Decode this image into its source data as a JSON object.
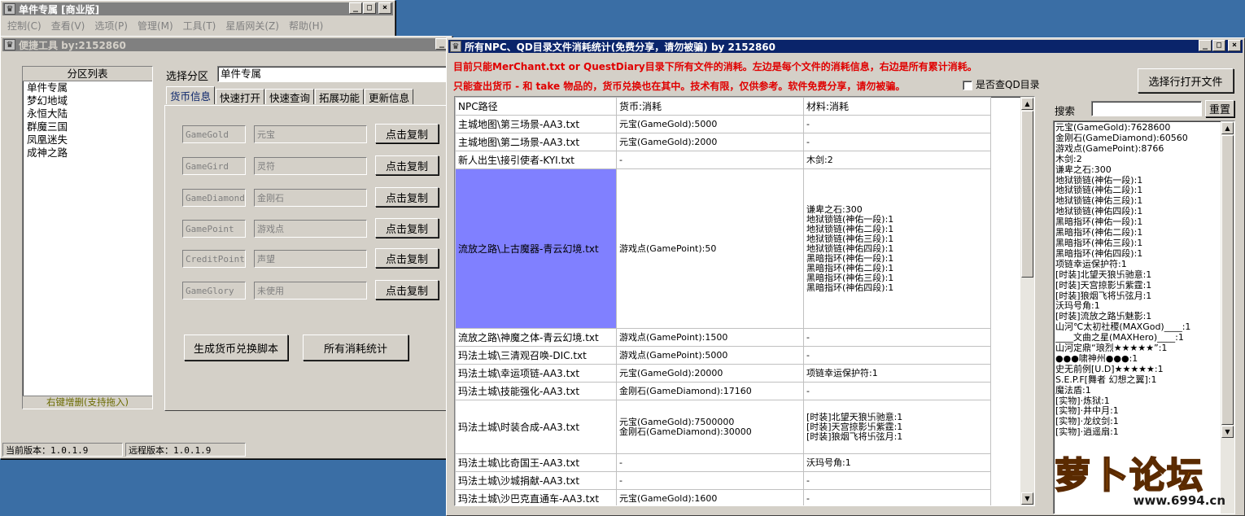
{
  "main_window": {
    "title": "单件专属 [商业版]",
    "menu": [
      "控制(C)",
      "查看(V)",
      "选项(P)",
      "管理(M)",
      "工具(T)",
      "星盾网关(Z)",
      "帮助(H)"
    ]
  },
  "tool_window": {
    "title": "便捷工具   by:2152860",
    "partition": {
      "header": "分区列表",
      "items": [
        "单件专属",
        "梦幻地域",
        "永恒大陆",
        "群魔三国",
        "凤凰迷失",
        "成神之路"
      ],
      "footer": "右键增删(支持拖入)"
    },
    "select_label": "选择分区",
    "select_value": "单件专属",
    "tabs": [
      "货币信息",
      "快速打开",
      "快速查询",
      "拓展功能",
      "更新信息"
    ],
    "currencies": [
      {
        "code": "GameGold",
        "name": "元宝",
        "button": "点击复制"
      },
      {
        "code": "GameGird",
        "name": "灵符",
        "button": "点击复制"
      },
      {
        "code": "GameDiamond",
        "name": "金刚石",
        "button": "点击复制"
      },
      {
        "code": "GamePoint",
        "name": "游戏点",
        "button": "点击复制"
      },
      {
        "code": "CreditPoint",
        "name": "声望",
        "button": "点击复制"
      },
      {
        "code": "GameGlory",
        "name": "未使用",
        "button": "点击复制"
      }
    ],
    "gen_button": "生成货币兑换脚本",
    "stats_button": "所有消耗统计",
    "status_local": "当前版本：1.0.1.9",
    "status_remote": "远程版本：1.0.1.9"
  },
  "stats_window": {
    "title": "所有NPC、QD目录文件消耗统计(免费分享，请勿被骗)    by 2152860",
    "notice1": "目前只能MerChant.txt or QuestDiary目录下所有文件的消耗。左边是每个文件的消耗信息，右边是所有累计消耗。",
    "notice2": "只能查出货币 - 和 take 物品的，货币兑换也在其中。技术有限，仅供参考。软件免费分享，请勿被骗。",
    "checkbox_label": "是否查QD目录",
    "open_button": "选择行打开文件",
    "search_label": "搜索",
    "reset_button": "重置",
    "columns": [
      "NPC路径",
      "货币:消耗",
      "材料:消耗"
    ],
    "rows": [
      {
        "path": "主城地图\\第三场景-AA3.txt",
        "cost": [
          "元宝(GameGold):5000"
        ],
        "mat": [
          "-"
        ]
      },
      {
        "path": "主城地图\\第二场景-AA3.txt",
        "cost": [
          "元宝(GameGold):2000"
        ],
        "mat": [
          "-"
        ]
      },
      {
        "path": "新人出生\\接引使者-KYI.txt",
        "cost": [
          "-"
        ],
        "mat": [
          "木剑:2"
        ]
      },
      {
        "path": "流放之路\\上古魔器-青云幻境.txt",
        "cost": [
          "游戏点(GamePoint):50"
        ],
        "mat": [
          "谦卑之石:300",
          "地狱锁链(神佑一段):1",
          "地狱锁链(神佑二段):1",
          "地狱锁链(神佑三段):1",
          "地狱锁链(神佑四段):1",
          "黑暗指环(神佑一段):1",
          "黑暗指环(神佑二段):1",
          "黑暗指环(神佑三段):1",
          "黑暗指环(神佑四段):1"
        ],
        "selected": true
      },
      {
        "path": "流放之路\\神魔之体-青云幻境.txt",
        "cost": [
          "游戏点(GamePoint):1500"
        ],
        "mat": [
          "-"
        ]
      },
      {
        "path": "玛法土城\\三清观召唤-DIC.txt",
        "cost": [
          "游戏点(GamePoint):5000"
        ],
        "mat": [
          "-"
        ]
      },
      {
        "path": "玛法土城\\幸运项链-AA3.txt",
        "cost": [
          "元宝(GameGold):20000"
        ],
        "mat": [
          "项链幸运保护符:1"
        ]
      },
      {
        "path": "玛法土城\\技能强化-AA3.txt",
        "cost": [
          "金刚石(GameDiamond):17160"
        ],
        "mat": [
          "-"
        ]
      },
      {
        "path": "玛法土城\\时装合成-AA3.txt",
        "cost": [
          "元宝(GameGold):7500000",
          "金刚石(GameDiamond):30000"
        ],
        "mat": [
          "[时装]北望天狼卐驰意:1",
          "[时装]天宫掠影卐紫霆:1",
          "[时装]狼烟飞将卐弦月:1"
        ]
      },
      {
        "path": "玛法土城\\比奇国王-AA3.txt",
        "cost": [
          "-"
        ],
        "mat": [
          "沃玛号角:1"
        ]
      },
      {
        "path": "玛法土城\\沙城捐献-AA3.txt",
        "cost": [
          "-"
        ],
        "mat": [
          "-"
        ]
      },
      {
        "path": "玛法土城\\沙巴克直通车-AA3.txt",
        "cost": [
          "元宝(GameGold):1600"
        ],
        "mat": [
          "-"
        ]
      }
    ],
    "summary": [
      "元宝(GameGold):7628600",
      "金刚石(GameDiamond):60560",
      "游戏点(GamePoint):8766",
      "木剑:2",
      "谦卑之石:300",
      "地狱锁链(神佑一段):1",
      "地狱锁链(神佑二段):1",
      "地狱锁链(神佑三段):1",
      "地狱锁链(神佑四段):1",
      "黑暗指环(神佑一段):1",
      "黑暗指环(神佑二段):1",
      "黑暗指环(神佑三段):1",
      "黑暗指环(神佑四段):1",
      "项链幸运保护符:1",
      "[时装]北望天狼卐驰意:1",
      "[时装]天宫掠影卐紫霆:1",
      "[时装]狼烟飞将卐弦月:1",
      "沃玛号角:1",
      "[时装]流放之路卐魅影:1",
      "山河℃太初社稷(MAXGod)____:1",
      "____文曲之星(MAXHero)____:1",
      "山河定鼎“琅烈★★★★★”:1",
      "●●●啸神州●●●:1",
      "史无前例[U.D]★★★★★:1",
      "S.E.P.F[舞者 幻想之翼]:1",
      "魔法盾:1",
      "[实物]·炼狱:1",
      "[实物]·井中月:1",
      "[实物]·龙纹剑:1",
      "[实物]·逍遥扇:1"
    ]
  },
  "watermark": {
    "brand": "萝卜论坛",
    "site": "www.6994.cn"
  }
}
